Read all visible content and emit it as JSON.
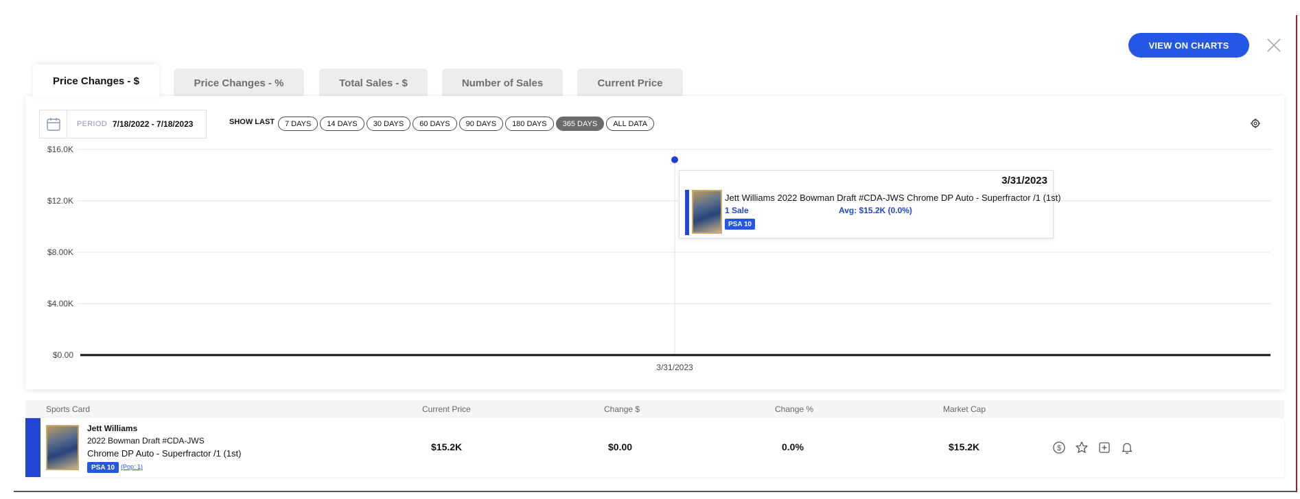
{
  "header": {
    "view_button_label": "VIEW ON CHARTS"
  },
  "tabs": [
    {
      "label": "Price Changes - $",
      "active": true
    },
    {
      "label": "Price Changes - %",
      "active": false
    },
    {
      "label": "Total Sales - $",
      "active": false
    },
    {
      "label": "Number of Sales",
      "active": false
    },
    {
      "label": "Current Price",
      "active": false
    }
  ],
  "controls": {
    "period_label": "PERIOD",
    "period_value": "7/18/2022 - 7/18/2023",
    "show_last_label": "SHOW LAST",
    "ranges": [
      "7 DAYS",
      "14 DAYS",
      "30 DAYS",
      "60 DAYS",
      "90 DAYS",
      "180 DAYS",
      "365 DAYS",
      "ALL DATA"
    ],
    "selected_range": "365 DAYS"
  },
  "chart_data": {
    "type": "line",
    "y_ticks": [
      "$16.0K",
      "$12.0K",
      "$8.00K",
      "$4.00K",
      "$0.00"
    ],
    "ylim": [
      0,
      16000
    ],
    "x_tick_labels": [
      "3/31/2023"
    ],
    "series": [
      {
        "points": [
          {
            "x": "3/31/2023",
            "y": 15200
          }
        ],
        "color": "#1f3fd6"
      }
    ],
    "baseline_color": "#111111",
    "grid": true
  },
  "tooltip": {
    "date": "3/31/2023",
    "title": "Jett Williams 2022 Bowman Draft #CDA-JWS Chrome DP Auto - Superfractor /1 (1st)",
    "sales": "1 Sale",
    "avg": "Avg: $15.2K (0.0%)",
    "grade": "PSA 10"
  },
  "table": {
    "headers": [
      "Sports Card",
      "Current Price",
      "Change $",
      "Change %",
      "Market Cap"
    ],
    "rows": [
      {
        "name": "Jett Williams",
        "line1": "2022 Bowman Draft #CDA-JWS",
        "line2": "Chrome DP Auto - Superfractor /1 (1st)",
        "grade": "PSA 10",
        "pop": "(Pop: 1)",
        "current_price": "$15.2K",
        "change_dollar": "$0.00",
        "change_percent": "0.0%",
        "market_cap": "$15.2K"
      }
    ]
  },
  "row_actions": [
    "dollar-circle-icon",
    "star-icon",
    "add-square-icon",
    "bell-icon"
  ],
  "colors": {
    "accent_blue": "#2457e6",
    "series_blue": "#1f3fd6",
    "selected_pill": "#6b6b6b"
  }
}
